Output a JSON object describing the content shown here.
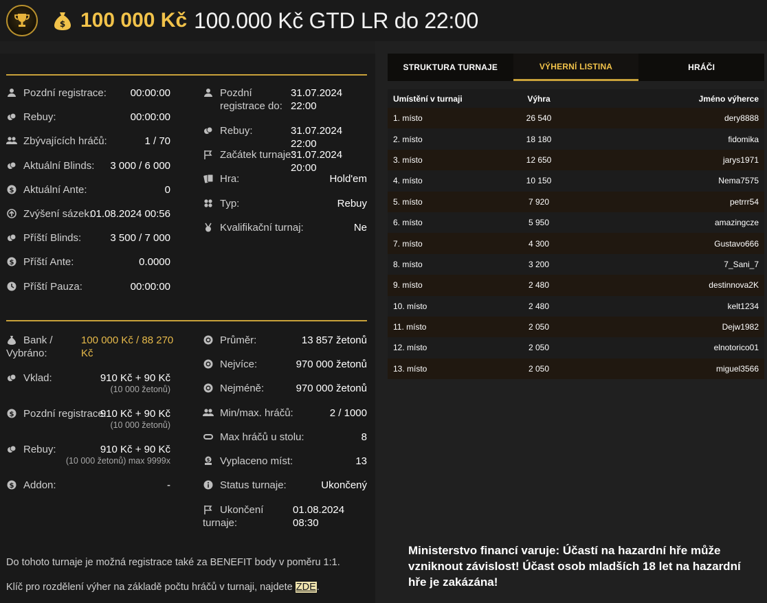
{
  "header": {
    "logo_icon": "trophy-logo-icon",
    "bag_icon": "money-bag-icon",
    "amount": "100 000 Kč",
    "title": "100.000 Kč GTD LR do 22:00"
  },
  "left_col1": [
    {
      "icon": "user-icon",
      "label": "Pozdní registrace:",
      "value": "00:00:00"
    },
    {
      "icon": "chips-icon",
      "label": "Rebuy:",
      "value": "00:00:00"
    },
    {
      "icon": "users-icon",
      "label": "Zbývajících hráčů:",
      "value": "1 / 70"
    },
    {
      "icon": "chips-icon",
      "label": "Aktuální Blinds:",
      "value": "3 000 / 6 000"
    },
    {
      "icon": "dollar-icon",
      "label": "Aktuální Ante:",
      "value": "0"
    },
    {
      "icon": "arrow-up-icon",
      "label": "Zvýšení sázek:",
      "value": "01.08.2024 00:56"
    },
    {
      "icon": "chips-icon",
      "label": "Příští Blinds:",
      "value": "3 500 / 7 000"
    },
    {
      "icon": "dollar-icon",
      "label": "Příští Ante:",
      "value": "0.0000"
    },
    {
      "icon": "clock-icon",
      "label": "Příští Pauza:",
      "value": "00:00:00"
    }
  ],
  "left_col2": [
    {
      "icon": "user-icon",
      "label": "Pozdní registrace do:",
      "value": "31.07.2024 22:00"
    },
    {
      "icon": "chips-icon",
      "label": "Rebuy:",
      "value": "31.07.2024 22:00"
    },
    {
      "icon": "flag-icon",
      "label": "Začátek turnaje:",
      "value": "31.07.2024 20:00"
    },
    {
      "icon": "cards-icon",
      "label": "Hra:",
      "value": "Hold'em"
    },
    {
      "icon": "clubs-icon",
      "label": "Typ:",
      "value": "Rebuy"
    },
    {
      "icon": "medal-icon",
      "label": "Kvalifikační turnaj:",
      "value": "Ne"
    }
  ],
  "bottom_col1": {
    "bank": {
      "icon": "bag-icon",
      "label_1": "Bank /",
      "label_2": "Vybráno:",
      "value_1": "100 000 Kč / 88 270",
      "value_2": "Kč"
    },
    "deposit": {
      "icon": "chips-icon",
      "label": "Vklad:",
      "value": "910 Kč + 90 Kč",
      "sub": "(10 000 žetonů)"
    },
    "late_reg": {
      "icon": "dollar-icon",
      "label": "Pozdní registrace:",
      "value": "910 Kč + 90 Kč",
      "sub": "(10 000 žetonů)"
    },
    "rebuy": {
      "icon": "chips-icon",
      "label": "Rebuy:",
      "value": "910 Kč + 90 Kč",
      "sub": "(10 000 žetonů) max 9999x"
    },
    "addon": {
      "icon": "dollar-icon",
      "label": "Addon:",
      "value": "-"
    }
  },
  "bottom_col2": [
    {
      "icon": "chip-icon",
      "label": "Průměr:",
      "value": "13 857 žetonů"
    },
    {
      "icon": "chip-icon",
      "label": "Nejvíce:",
      "value": "970 000 žetonů"
    },
    {
      "icon": "chip-icon",
      "label": "Nejméně:",
      "value": "970 000 žetonů"
    },
    {
      "icon": "users-icon",
      "label": "Min/max. hráčů:",
      "value": "2 / 1000"
    },
    {
      "icon": "table-icon",
      "label": "Max hráčů u stolu:",
      "value": "8"
    },
    {
      "icon": "payout-icon",
      "label": "Vyplaceno míst:",
      "value": "13"
    },
    {
      "icon": "info-icon",
      "label": "Status turnaje:",
      "value": "Ukončený"
    }
  ],
  "end": {
    "icon": "flag-icon",
    "label_1": "Ukončení",
    "label_2": "turnaje:",
    "value_1": "01.08.2024",
    "value_2": "08:30"
  },
  "notes": {
    "benefit": "Do tohoto turnaje je možná registrace také za BENEFIT body v poměru 1:1.",
    "key_text": "Klíč pro rozdělení výher na základě počtu hráčů v turnaji, najdete ",
    "key_link": "ZDE",
    "key_end": "."
  },
  "tabs": [
    "STRUKTURA TURNAJE",
    "VÝHERNÍ LISTINA",
    "HRÁČI"
  ],
  "table": {
    "headers": [
      "Umístění v turnaji",
      "Výhra",
      "Jméno výherce"
    ],
    "rows": [
      [
        "1. místo",
        "26 540",
        "dery8888"
      ],
      [
        "2. místo",
        "18 180",
        "fidomika"
      ],
      [
        "3. místo",
        "12 650",
        "jarys1971"
      ],
      [
        "4. místo",
        "10 150",
        "Nema7575"
      ],
      [
        "5. místo",
        "7 920",
        "petrrr54"
      ],
      [
        "6. místo",
        "5 950",
        "amazingcze"
      ],
      [
        "7. místo",
        "4 300",
        "Gustavo666"
      ],
      [
        "8. místo",
        "3 200",
        "7_Sani_7"
      ],
      [
        "9. místo",
        "2 480",
        "destinnova2K"
      ],
      [
        "10. místo",
        "2 480",
        "kelt1234"
      ],
      [
        "11. místo",
        "2 050",
        "Dejw1982"
      ],
      [
        "12. místo",
        "2 050",
        "elnotorico01"
      ],
      [
        "13. místo",
        "2 050",
        "miguel3566"
      ]
    ]
  },
  "warning": "Ministerstvo financí varuje: Účastí na hazardní hře může vzniknout závislost! Účast osob mladších 18 let na hazardní hře je zakázána!"
}
